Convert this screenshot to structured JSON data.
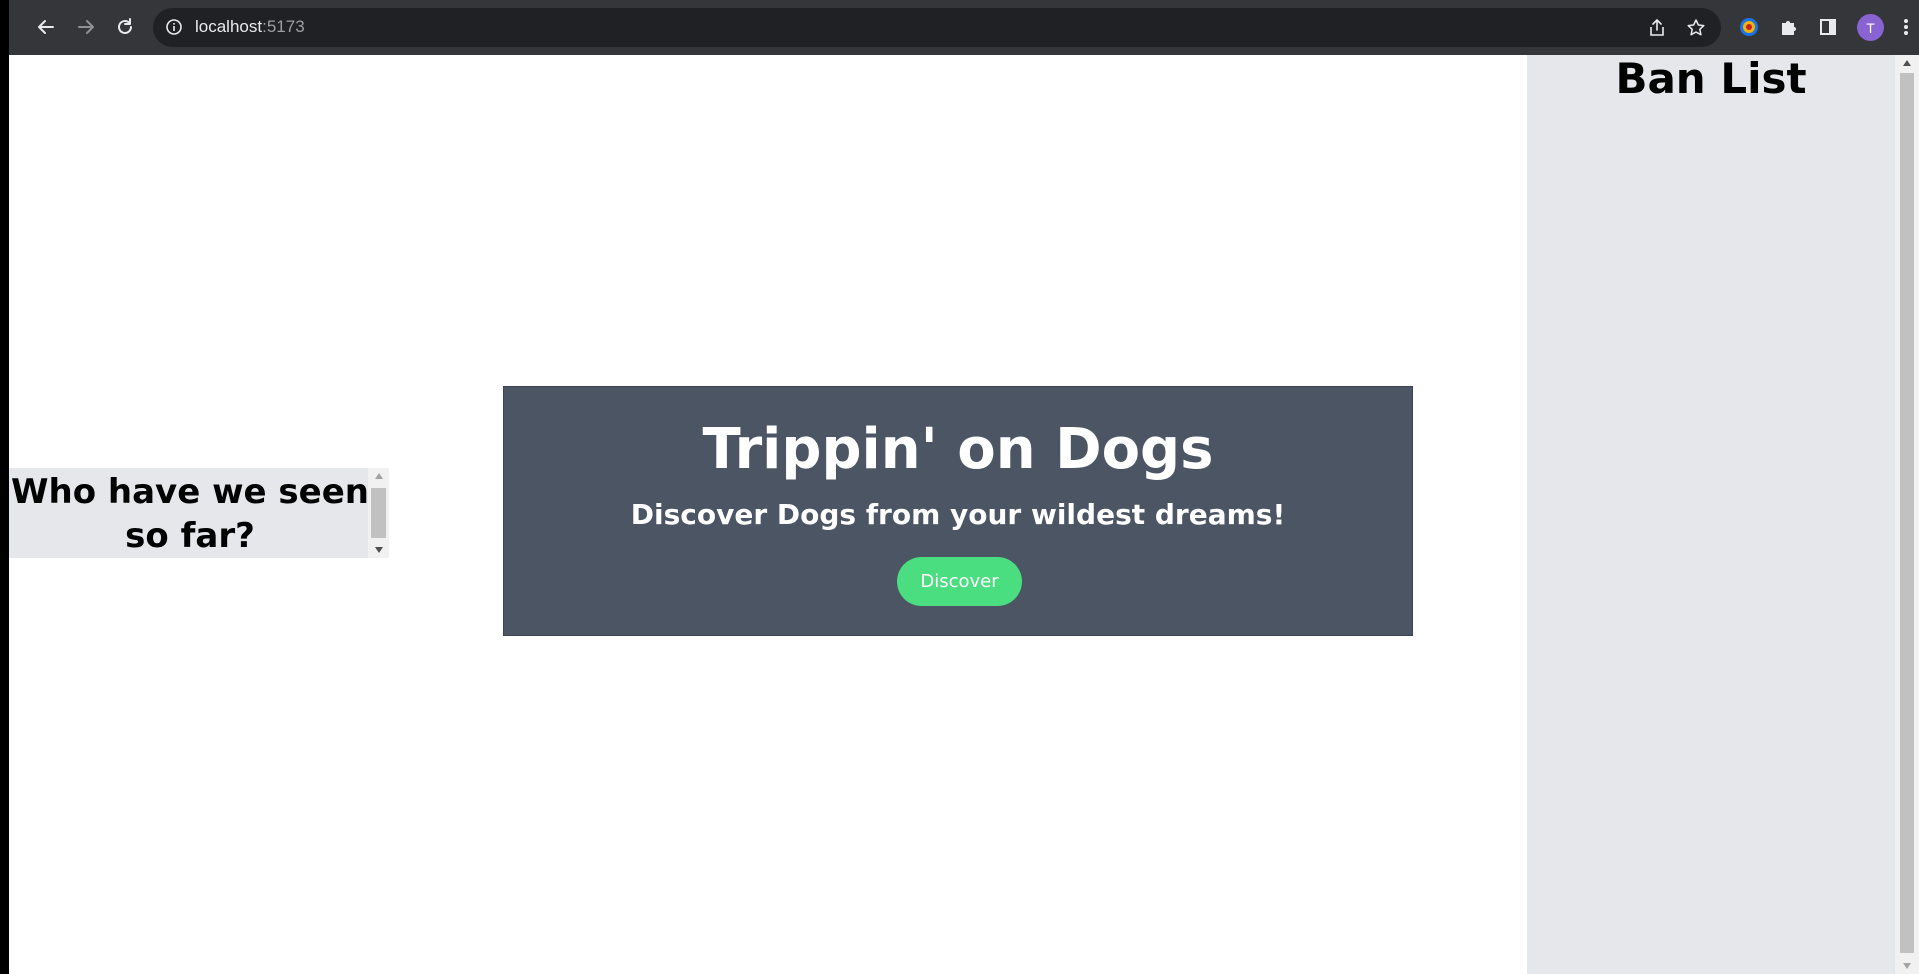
{
  "browser": {
    "url_host": "localhost",
    "url_port": ":5173",
    "avatar_initial": "T",
    "icons": [
      "back-arrow-icon",
      "forward-arrow-icon",
      "reload-icon",
      "info-icon",
      "share-icon",
      "star-icon",
      "extension-icon",
      "puzzle-icon",
      "side-panel-icon",
      "kebab-menu-icon"
    ]
  },
  "seen": {
    "title": "Who have we seen so far?"
  },
  "hero": {
    "title": "Trippin' on Dogs",
    "subtitle": "Discover Dogs from your wildest dreams!",
    "button_label": "Discover"
  },
  "ban_list": {
    "title": "Ban List"
  },
  "colors": {
    "card_bg": "#4b5563",
    "panel_bg": "#e5e7eb",
    "button_bg": "#4ade80",
    "toolbar_bg": "#35363a",
    "omnibox_bg": "#202124",
    "avatar_bg": "#8a63d2"
  }
}
